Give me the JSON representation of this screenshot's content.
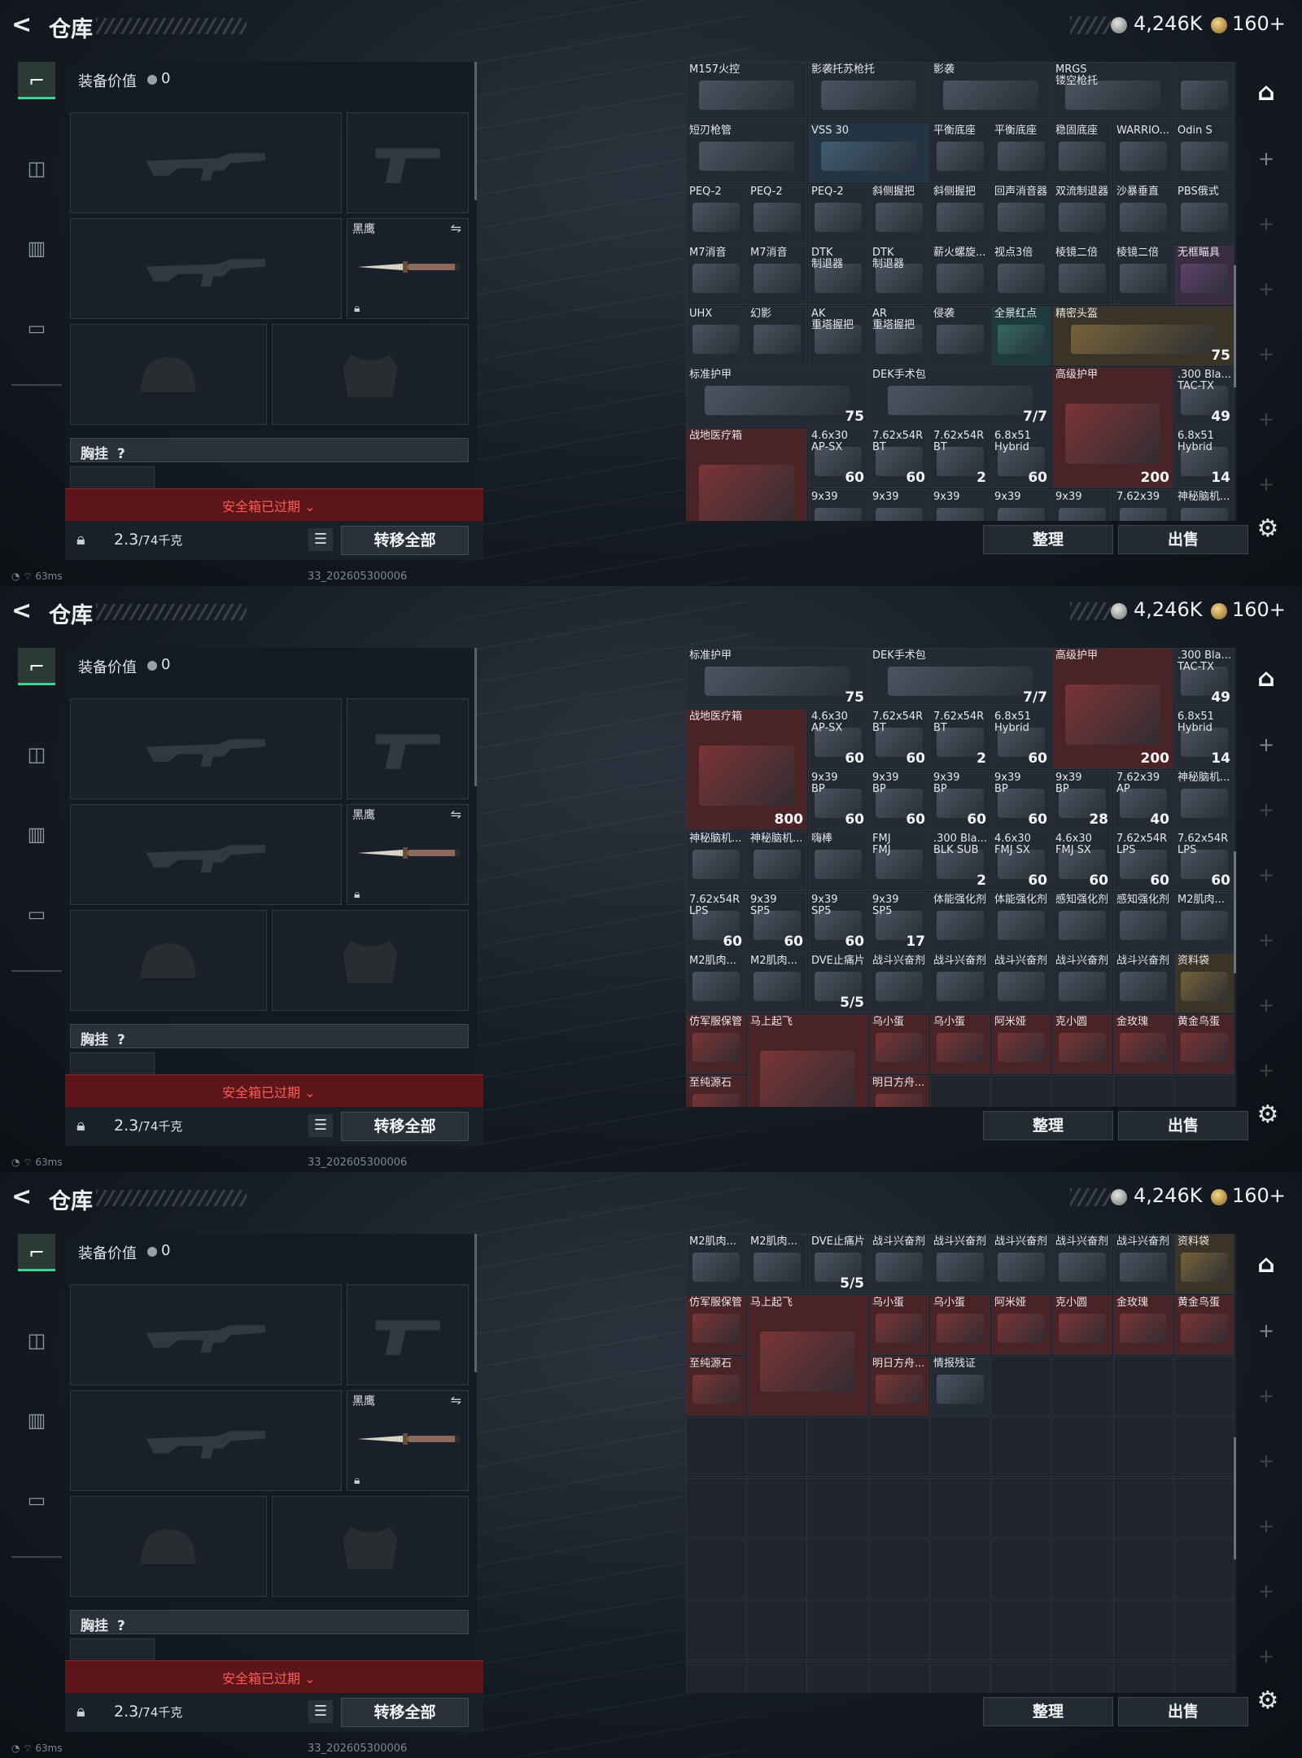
{
  "header": {
    "back_label": "<",
    "title": "仓库",
    "silver": "4,246K",
    "gold": "160+"
  },
  "nav": {
    "tabs": [
      {
        "icon": "gun-icon"
      },
      {
        "icon": "backpack-icon"
      },
      {
        "icon": "vest-icon"
      },
      {
        "icon": "case-icon"
      }
    ]
  },
  "equipment": {
    "value_label": "装备价值",
    "value": "0",
    "knife_name": "黑鹰",
    "chest_label": "胸挂",
    "chest_help": "?",
    "safe_expired": "安全箱已过期 ⌄",
    "weight": "2.3",
    "weight_unit": "/74千克",
    "transfer_all": "转移全部"
  },
  "actions": {
    "sort": "整理",
    "sell": "出售"
  },
  "status": {
    "ping": "63ms",
    "build": "33_202605300006"
  },
  "views": [
    {
      "cells": [
        {
          "n": "M157火控",
          "w": 2,
          "h": 1,
          "c": "dark"
        },
        {
          "n": "影袭托苏枪托",
          "w": 2,
          "h": 1,
          "c": "dark"
        },
        {
          "n": "影袭",
          "w": 2,
          "h": 1,
          "c": "dark"
        },
        {
          "n": "MRGS\n镂空枪托",
          "w": 2,
          "h": 1,
          "c": "dark"
        },
        {
          "n": "",
          "w": 1,
          "h": 1,
          "c": "dark"
        },
        {
          "n": "短刃枪管",
          "w": 2,
          "h": 1,
          "c": "dark"
        },
        {
          "n": "VSS 30",
          "w": 2,
          "h": 1,
          "c": "blue"
        },
        {
          "n": "平衡底座",
          "w": 1,
          "h": 1,
          "c": "dark"
        },
        {
          "n": "平衡底座",
          "w": 1,
          "h": 1,
          "c": "dark"
        },
        {
          "n": "稳固底座",
          "w": 1,
          "h": 1,
          "c": "dark"
        },
        {
          "n": "WARRIO...",
          "w": 1,
          "h": 1,
          "c": "dark"
        },
        {
          "n": "Odin S",
          "w": 1,
          "h": 1,
          "c": "dark"
        },
        {
          "n": "PEQ-2",
          "w": 1,
          "h": 1,
          "c": "dark"
        },
        {
          "n": "PEQ-2",
          "w": 1,
          "h": 1,
          "c": "dark"
        },
        {
          "n": "PEQ-2",
          "w": 1,
          "h": 1,
          "c": "dark"
        },
        {
          "n": "斜侧握把",
          "w": 1,
          "h": 1,
          "c": "dark"
        },
        {
          "n": "斜侧握把",
          "w": 1,
          "h": 1,
          "c": "dark"
        },
        {
          "n": "回声消音器",
          "w": 1,
          "h": 1,
          "c": "dark"
        },
        {
          "n": "双流制退器",
          "w": 1,
          "h": 1,
          "c": "dark"
        },
        {
          "n": "沙暴垂直",
          "w": 1,
          "h": 1,
          "c": "dark"
        },
        {
          "n": "PBS俄式",
          "w": 1,
          "h": 1,
          "c": "dark"
        },
        {
          "n": "M7消音",
          "w": 1,
          "h": 1,
          "c": "dark"
        },
        {
          "n": "M7消音",
          "w": 1,
          "h": 1,
          "c": "dark"
        },
        {
          "n": "DTK\n制退器",
          "w": 1,
          "h": 1,
          "c": "dark"
        },
        {
          "n": "DTK\n制退器",
          "w": 1,
          "h": 1,
          "c": "dark"
        },
        {
          "n": "薪火螺旋...",
          "w": 1,
          "h": 1,
          "c": "dark"
        },
        {
          "n": "视点3倍",
          "w": 1,
          "h": 1,
          "c": "dark"
        },
        {
          "n": "棱镜二倍",
          "w": 1,
          "h": 1,
          "c": "dark"
        },
        {
          "n": "棱镜二倍",
          "w": 1,
          "h": 1,
          "c": "dark"
        },
        {
          "n": "无框瞄具",
          "w": 1,
          "h": 1,
          "c": "purple"
        },
        {
          "n": "UHX",
          "w": 1,
          "h": 1,
          "c": "dark"
        },
        {
          "n": "幻影",
          "w": 1,
          "h": 1,
          "c": "dark"
        },
        {
          "n": "AK\n重塔握把",
          "w": 1,
          "h": 1,
          "c": "dark"
        },
        {
          "n": "AR\n重塔握把",
          "w": 1,
          "h": 1,
          "c": "dark"
        },
        {
          "n": "侵袭",
          "w": 1,
          "h": 1,
          "c": "dark"
        },
        {
          "n": "全景红点",
          "w": 1,
          "h": 1,
          "c": "teal"
        },
        {
          "n": "精密头盔",
          "w": 3,
          "h": 1,
          "c": "gold",
          "ct": "75"
        },
        {
          "n": "标准护甲",
          "w": 3,
          "h": 1,
          "c": "dark",
          "ct": "75"
        },
        {
          "n": "DEK手术包",
          "w": 3,
          "h": 1,
          "c": "dark",
          "ct": "7/7"
        },
        {
          "n": "高级护甲",
          "w": 2,
          "h": 2,
          "c": "red",
          "ct": "200"
        },
        {
          "n": ".300 Bla...\nTAC-TX",
          "w": 1,
          "h": 1,
          "c": "dark",
          "ct": "49"
        },
        {
          "n": "战地医疗箱",
          "w": 2,
          "h": 2,
          "c": "red",
          "ct": ""
        },
        {
          "n": "4.6x30\nAP-SX",
          "w": 1,
          "h": 1,
          "c": "dark",
          "ct": "60"
        },
        {
          "n": "7.62x54R\nBT",
          "w": 1,
          "h": 1,
          "c": "dark",
          "ct": "60"
        },
        {
          "n": "7.62x54R\nBT",
          "w": 1,
          "h": 1,
          "c": "dark",
          "ct": "2"
        },
        {
          "n": "6.8x51\nHybrid",
          "w": 1,
          "h": 1,
          "c": "dark",
          "ct": "60"
        },
        {
          "n": "6.8x51\nHybrid",
          "w": 1,
          "h": 1,
          "c": "dark",
          "ct": "14"
        },
        {
          "n": "9x39",
          "w": 1,
          "h": 1,
          "c": "dark"
        },
        {
          "n": "9x39",
          "w": 1,
          "h": 1,
          "c": "dark"
        },
        {
          "n": "9x39",
          "w": 1,
          "h": 1,
          "c": "dark"
        },
        {
          "n": "9x39",
          "w": 1,
          "h": 1,
          "c": "dark"
        },
        {
          "n": "9x39",
          "w": 1,
          "h": 1,
          "c": "dark"
        },
        {
          "n": "7.62x39",
          "w": 1,
          "h": 1,
          "c": "dark"
        },
        {
          "n": "神秘脑机...",
          "w": 1,
          "h": 1,
          "c": "dark"
        }
      ]
    },
    {
      "cells": [
        {
          "n": "标准护甲",
          "w": 3,
          "h": 1,
          "c": "dark",
          "ct": "75"
        },
        {
          "n": "DEK手术包",
          "w": 3,
          "h": 1,
          "c": "dark",
          "ct": "7/7"
        },
        {
          "n": "高级护甲",
          "w": 2,
          "h": 2,
          "c": "red",
          "ct": "200"
        },
        {
          "n": ".300 Bla...\nTAC-TX",
          "w": 1,
          "h": 1,
          "c": "dark",
          "ct": "49"
        },
        {
          "n": "战地医疗箱",
          "w": 2,
          "h": 2,
          "c": "red",
          "ct": "800"
        },
        {
          "n": "4.6x30\nAP-SX",
          "w": 1,
          "h": 1,
          "c": "dark",
          "ct": "60"
        },
        {
          "n": "7.62x54R\nBT",
          "w": 1,
          "h": 1,
          "c": "dark",
          "ct": "60"
        },
        {
          "n": "7.62x54R\nBT",
          "w": 1,
          "h": 1,
          "c": "dark",
          "ct": "2"
        },
        {
          "n": "6.8x51\nHybrid",
          "w": 1,
          "h": 1,
          "c": "dark",
          "ct": "60"
        },
        {
          "n": "6.8x51\nHybrid",
          "w": 1,
          "h": 1,
          "c": "dark",
          "ct": "14"
        },
        {
          "n": "9x39\nBP",
          "w": 1,
          "h": 1,
          "c": "dark",
          "ct": "60"
        },
        {
          "n": "9x39\nBP",
          "w": 1,
          "h": 1,
          "c": "dark",
          "ct": "60"
        },
        {
          "n": "9x39\nBP",
          "w": 1,
          "h": 1,
          "c": "dark",
          "ct": "60"
        },
        {
          "n": "9x39\nBP",
          "w": 1,
          "h": 1,
          "c": "dark",
          "ct": "60"
        },
        {
          "n": "9x39\nBP",
          "w": 1,
          "h": 1,
          "c": "dark",
          "ct": "28"
        },
        {
          "n": "7.62x39\nAP",
          "w": 1,
          "h": 1,
          "c": "dark",
          "ct": "40"
        },
        {
          "n": "神秘脑机...",
          "w": 1,
          "h": 1,
          "c": "dark"
        },
        {
          "n": "神秘脑机...",
          "w": 1,
          "h": 1,
          "c": "dark"
        },
        {
          "n": "神秘脑机...",
          "w": 1,
          "h": 1,
          "c": "dark"
        },
        {
          "n": "嗨棒",
          "w": 1,
          "h": 1,
          "c": "dark"
        },
        {
          "n": "FMJ\nFMJ",
          "w": 1,
          "h": 1,
          "c": "dark"
        },
        {
          "n": ".300 Bla...\nBLK SUB",
          "w": 1,
          "h": 1,
          "c": "dark",
          "ct": "2"
        },
        {
          "n": "4.6x30\nFMJ SX",
          "w": 1,
          "h": 1,
          "c": "dark",
          "ct": "60"
        },
        {
          "n": "4.6x30\nFMJ SX",
          "w": 1,
          "h": 1,
          "c": "dark",
          "ct": "60"
        },
        {
          "n": "7.62x54R\nLPS",
          "w": 1,
          "h": 1,
          "c": "dark",
          "ct": "60"
        },
        {
          "n": "7.62x54R\nLPS",
          "w": 1,
          "h": 1,
          "c": "dark",
          "ct": "60"
        },
        {
          "n": "7.62x54R\nLPS",
          "w": 1,
          "h": 1,
          "c": "dark",
          "ct": "60"
        },
        {
          "n": "9x39\nSP5",
          "w": 1,
          "h": 1,
          "c": "dark",
          "ct": "60"
        },
        {
          "n": "9x39\nSP5",
          "w": 1,
          "h": 1,
          "c": "dark",
          "ct": "60"
        },
        {
          "n": "9x39\nSP5",
          "w": 1,
          "h": 1,
          "c": "dark",
          "ct": "17"
        },
        {
          "n": "体能强化剂",
          "w": 1,
          "h": 1,
          "c": "dark"
        },
        {
          "n": "体能强化剂",
          "w": 1,
          "h": 1,
          "c": "dark"
        },
        {
          "n": "感知强化剂",
          "w": 1,
          "h": 1,
          "c": "dark"
        },
        {
          "n": "感知强化剂",
          "w": 1,
          "h": 1,
          "c": "dark"
        },
        {
          "n": "M2肌肉...",
          "w": 1,
          "h": 1,
          "c": "dark"
        },
        {
          "n": "M2肌肉...",
          "w": 1,
          "h": 1,
          "c": "dark"
        },
        {
          "n": "M2肌肉...",
          "w": 1,
          "h": 1,
          "c": "dark"
        },
        {
          "n": "DVE止痛片",
          "w": 1,
          "h": 1,
          "c": "dark",
          "ct": "5/5"
        },
        {
          "n": "战斗兴奋剂",
          "w": 1,
          "h": 1,
          "c": "dark"
        },
        {
          "n": "战斗兴奋剂",
          "w": 1,
          "h": 1,
          "c": "dark"
        },
        {
          "n": "战斗兴奋剂",
          "w": 1,
          "h": 1,
          "c": "dark"
        },
        {
          "n": "战斗兴奋剂",
          "w": 1,
          "h": 1,
          "c": "dark"
        },
        {
          "n": "战斗兴奋剂",
          "w": 1,
          "h": 1,
          "c": "dark"
        },
        {
          "n": "资料袋",
          "w": 1,
          "h": 1,
          "c": "gold"
        },
        {
          "n": "仿军服保管",
          "w": 1,
          "h": 1,
          "c": "red"
        },
        {
          "n": "马上起飞",
          "w": 2,
          "h": 2,
          "c": "red"
        },
        {
          "n": "乌小蛋",
          "w": 1,
          "h": 1,
          "c": "red"
        },
        {
          "n": "乌小蛋",
          "w": 1,
          "h": 1,
          "c": "red"
        },
        {
          "n": "阿米娅",
          "w": 1,
          "h": 1,
          "c": "red"
        },
        {
          "n": "克小圆",
          "w": 1,
          "h": 1,
          "c": "red"
        },
        {
          "n": "金玫瑰",
          "w": 1,
          "h": 1,
          "c": "red"
        },
        {
          "n": "黄金鸟蛋",
          "w": 1,
          "h": 1,
          "c": "red"
        },
        {
          "n": "至纯源石",
          "w": 1,
          "h": 1,
          "c": "red"
        },
        {
          "n": "明日方舟...",
          "w": 1,
          "h": 1,
          "c": "red"
        }
      ]
    },
    {
      "cells": [
        {
          "n": "M2肌肉...",
          "w": 1,
          "h": 1,
          "c": "dark"
        },
        {
          "n": "M2肌肉...",
          "w": 1,
          "h": 1,
          "c": "dark"
        },
        {
          "n": "DVE止痛片",
          "w": 1,
          "h": 1,
          "c": "dark",
          "ct": "5/5"
        },
        {
          "n": "战斗兴奋剂",
          "w": 1,
          "h": 1,
          "c": "dark"
        },
        {
          "n": "战斗兴奋剂",
          "w": 1,
          "h": 1,
          "c": "dark"
        },
        {
          "n": "战斗兴奋剂",
          "w": 1,
          "h": 1,
          "c": "dark"
        },
        {
          "n": "战斗兴奋剂",
          "w": 1,
          "h": 1,
          "c": "dark"
        },
        {
          "n": "战斗兴奋剂",
          "w": 1,
          "h": 1,
          "c": "dark"
        },
        {
          "n": "资料袋",
          "w": 1,
          "h": 1,
          "c": "gold"
        },
        {
          "n": "仿军服保管",
          "w": 1,
          "h": 1,
          "c": "red"
        },
        {
          "n": "马上起飞",
          "w": 2,
          "h": 2,
          "c": "red"
        },
        {
          "n": "乌小蛋",
          "w": 1,
          "h": 1,
          "c": "red"
        },
        {
          "n": "乌小蛋",
          "w": 1,
          "h": 1,
          "c": "red"
        },
        {
          "n": "阿米娅",
          "w": 1,
          "h": 1,
          "c": "red"
        },
        {
          "n": "克小圆",
          "w": 1,
          "h": 1,
          "c": "red"
        },
        {
          "n": "金玫瑰",
          "w": 1,
          "h": 1,
          "c": "red"
        },
        {
          "n": "黄金鸟蛋",
          "w": 1,
          "h": 1,
          "c": "red"
        },
        {
          "n": "至纯源石",
          "w": 1,
          "h": 1,
          "c": "red"
        },
        {
          "n": "明日方舟...",
          "w": 1,
          "h": 1,
          "c": "red"
        },
        {
          "n": "情报残证",
          "w": 1,
          "h": 1,
          "c": "dark"
        }
      ]
    }
  ]
}
